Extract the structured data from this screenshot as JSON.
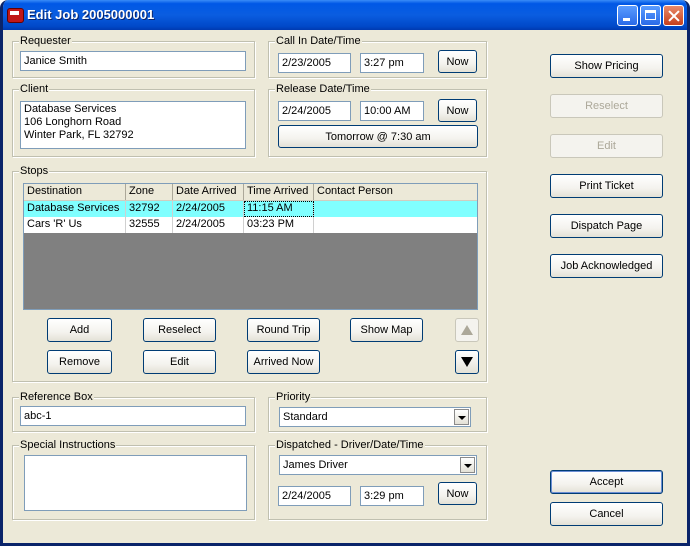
{
  "title": "Edit Job 2005000001",
  "requester": {
    "label": "Requester",
    "value": "Janice Smith"
  },
  "client": {
    "label": "Client",
    "lines": [
      "Database Services",
      "106 Longhorn Road",
      "Winter Park, FL 32792"
    ]
  },
  "call_in": {
    "label": "Call In Date/Time",
    "date": "2/23/2005",
    "time": "3:27 pm",
    "now_label": "Now"
  },
  "release": {
    "label": "Release Date/Time",
    "date": "2/24/2005",
    "time": "10:00 AM",
    "now_label": "Now",
    "tomorrow_label": "Tomorrow @ 7:30 am"
  },
  "stops": {
    "label": "Stops",
    "columns": [
      "Destination",
      "Zone",
      "Date Arrived",
      "Time Arrived",
      "Contact Person"
    ],
    "rows": [
      [
        "Database Services",
        "32792",
        "2/24/2005",
        "11:15 AM",
        ""
      ],
      [
        "Cars 'R' Us",
        "32555",
        "2/24/2005",
        "03:23 PM",
        ""
      ]
    ],
    "buttons": {
      "add": "Add",
      "reselect": "Reselect",
      "round_trip": "Round Trip",
      "show_map": "Show Map",
      "remove": "Remove",
      "edit": "Edit",
      "arrived_now": "Arrived Now"
    }
  },
  "reference": {
    "label": "Reference Box",
    "value": "abc-1"
  },
  "priority": {
    "label": "Priority",
    "value": "Standard"
  },
  "special": {
    "label": "Special Instructions",
    "value": ""
  },
  "dispatched": {
    "label": "Dispatched - Driver/Date/Time",
    "driver": "James Driver",
    "date": "2/24/2005",
    "time": "3:29 pm",
    "now_label": "Now"
  },
  "side": {
    "show_pricing": "Show Pricing",
    "reselect": "Reselect",
    "edit": "Edit",
    "print_ticket": "Print Ticket",
    "dispatch_page": "Dispatch Page",
    "job_ack": "Job Acknowledged"
  },
  "footer": {
    "accept": "Accept",
    "cancel": "Cancel"
  }
}
